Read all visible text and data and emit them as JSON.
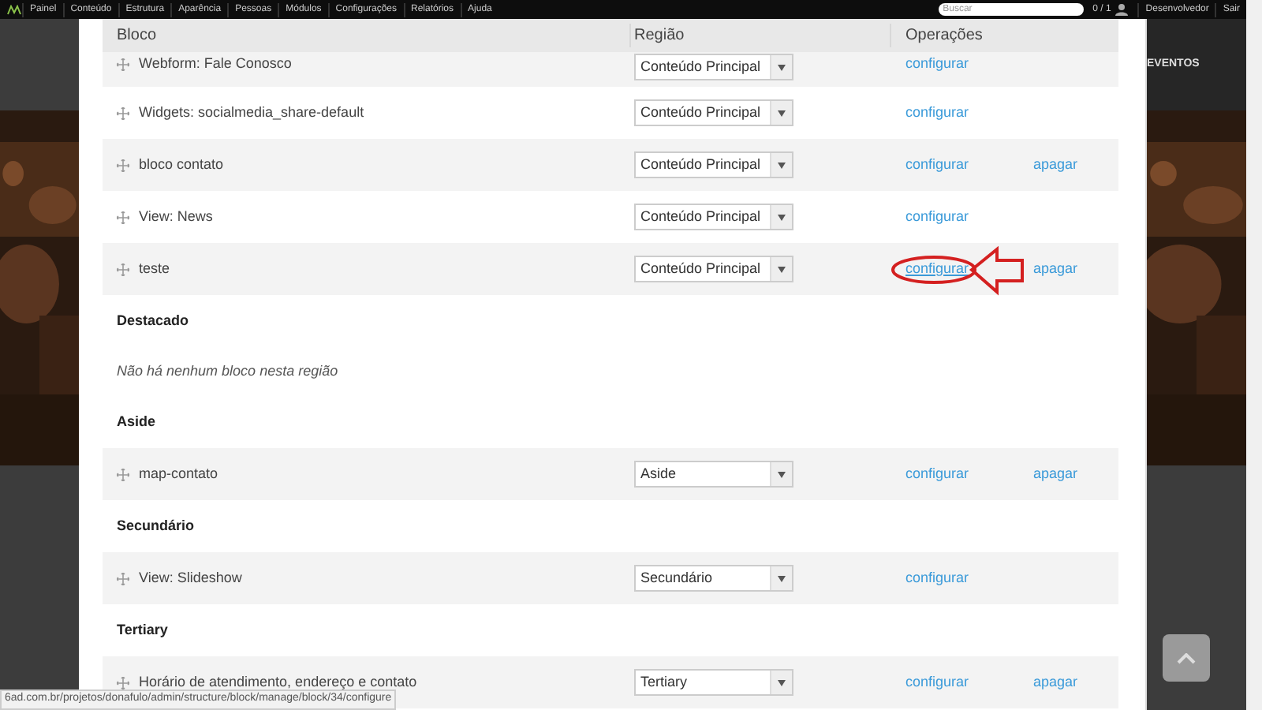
{
  "toolbar": {
    "menu": [
      "Painel",
      "Conteúdo",
      "Estrutura",
      "Aparência",
      "Pessoas",
      "Módulos",
      "Configurações",
      "Relatórios",
      "Ajuda"
    ],
    "search": {
      "placeholder": "Buscar"
    },
    "counter": "0 / 1",
    "user": "Desenvolvedor",
    "logout": "Sair"
  },
  "background": {
    "nav_item": "EVENTOS"
  },
  "table": {
    "columns": [
      "Bloco",
      "Região",
      "Operações"
    ],
    "items": [
      {
        "kind": "row",
        "block": "Webform: Fale Conosco",
        "region": "Conteúdo Principal",
        "operations": [
          "configurar"
        ]
      },
      {
        "kind": "row",
        "block": "Widgets: socialmedia_share-default",
        "region": "Conteúdo Principal",
        "operations": [
          "configurar"
        ]
      },
      {
        "kind": "row",
        "block": "bloco contato",
        "region": "Conteúdo Principal",
        "operations": [
          "configurar",
          "apagar"
        ]
      },
      {
        "kind": "row",
        "block": "View: News",
        "region": "Conteúdo Principal",
        "operations": [
          "configurar"
        ]
      },
      {
        "kind": "row",
        "block": "teste",
        "region": "Conteúdo Principal",
        "operations": [
          "configurar",
          "apagar"
        ],
        "hovered": true
      },
      {
        "kind": "region",
        "title": "Destacado"
      },
      {
        "kind": "empty",
        "text": "Não há nenhum bloco nesta região"
      },
      {
        "kind": "region",
        "title": "Aside"
      },
      {
        "kind": "row",
        "block": "map-contato",
        "region": "Aside",
        "operations": [
          "configurar",
          "apagar"
        ]
      },
      {
        "kind": "region",
        "title": "Secundário"
      },
      {
        "kind": "row",
        "block": "View: Slideshow",
        "region": "Secundário",
        "operations": [
          "configurar"
        ]
      },
      {
        "kind": "region",
        "title": "Tertiary"
      },
      {
        "kind": "row",
        "block": "Horário de atendimento, endereço e contato",
        "region": "Tertiary",
        "operations": [
          "configurar",
          "apagar"
        ]
      }
    ]
  },
  "status_bar": {
    "url": "6ad.com.br/projetos/donafulo/admin/structure/block/manage/block/34/configure"
  }
}
